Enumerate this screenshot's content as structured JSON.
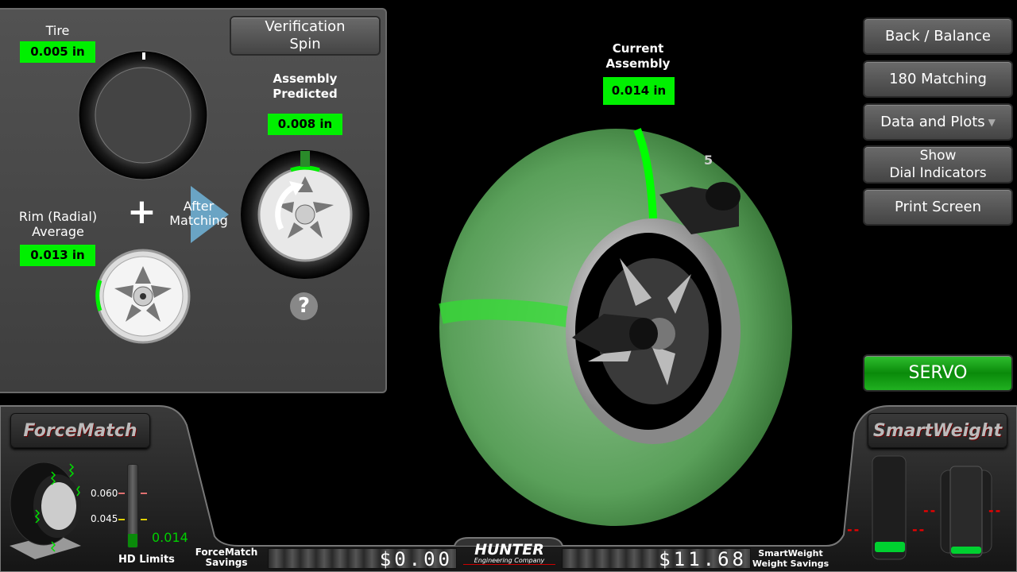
{
  "left": {
    "tire_label": "Tire",
    "tire_value": "0.005 in",
    "rim_label": "Rim (Radial)\nAverage",
    "rim_value": "0.013 in",
    "plus": "+",
    "after_matching": "After\nMatching",
    "verification_spin": "Verification\nSpin",
    "predicted_label": "Assembly\nPredicted",
    "predicted_value": "0.008 in",
    "help": "?"
  },
  "center": {
    "current_label": "Current\nAssembly",
    "current_value": "0.014 in",
    "weight_position": "5"
  },
  "menu": {
    "back_balance": "Back / Balance",
    "matching_180": "180 Matching",
    "data_plots": "Data and Plots",
    "show_dial": "Show\nDial Indicators",
    "print_screen": "Print Screen",
    "servo": "SERVO"
  },
  "forcematch": {
    "logo": "ForceMatch",
    "limit_high": "0.060",
    "limit_low": "0.045",
    "value": "0.014",
    "level_fraction": 0.06,
    "hd_limits": "HD Limits",
    "savings_label": "ForceMatch\nSavings",
    "savings": "$0.00"
  },
  "brand": {
    "name": "HUNTER",
    "sub": "Engineering Company"
  },
  "smartweight": {
    "logo": "SmartWeight",
    "savings": "$11.68",
    "savings_label": "SmartWeight\nWeight Savings",
    "static_left": "--",
    "static_right": "--",
    "dynamic_left": "--",
    "dynamic_right": "--"
  },
  "colors": {
    "accent_green": "#00f000",
    "limit_high": "#e07070",
    "limit_low": "#e0d000"
  }
}
